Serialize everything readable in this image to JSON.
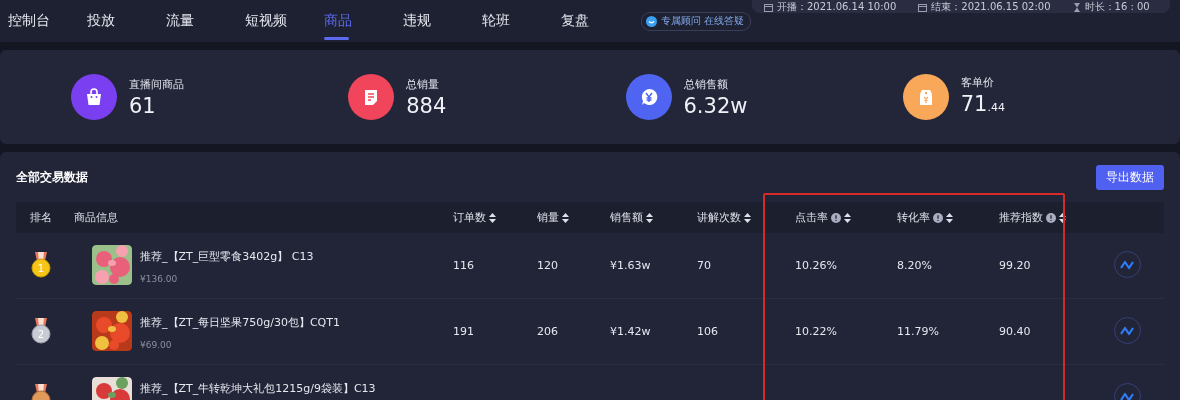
{
  "nav": {
    "tabs": [
      {
        "label": "控制台",
        "selected": false
      },
      {
        "label": "投放",
        "selected": false
      },
      {
        "label": "流量",
        "selected": false
      },
      {
        "label": "短视频",
        "selected": false
      },
      {
        "label": "商品",
        "selected": true
      },
      {
        "label": "违规",
        "selected": false
      },
      {
        "label": "轮班",
        "selected": false
      },
      {
        "label": "复盘",
        "selected": false
      }
    ],
    "advisor_badge": "专属顾问 在线答疑",
    "session_info": [
      {
        "kind": "start",
        "text": "开播：2021.06.14 10:00"
      },
      {
        "kind": "end",
        "text": "结束：2021.06.15 02:00"
      },
      {
        "kind": "duration",
        "text": "时长：16 : 00"
      }
    ]
  },
  "stats": [
    {
      "kind": "bag",
      "color": "#7b3ff2",
      "label": "直播间商品",
      "value": "61"
    },
    {
      "kind": "note",
      "color": "#f0455a",
      "label": "总销量",
      "value": "884"
    },
    {
      "kind": "yen",
      "color": "#4f64f0",
      "label": "总销售额",
      "value": "6.32w"
    },
    {
      "kind": "tag",
      "color": "#f9a85a",
      "label": "客单价",
      "value": "71",
      "value_small": ".44"
    }
  ],
  "table": {
    "title": "全部交易数据",
    "export_button": "导出数据",
    "columns": [
      {
        "label": "排名",
        "sortable": false,
        "info": false
      },
      {
        "label": "商品信息",
        "sortable": false,
        "info": false
      },
      {
        "label": "订单数",
        "sortable": true,
        "info": false
      },
      {
        "label": "销量",
        "sortable": true,
        "info": false
      },
      {
        "label": "销售额",
        "sortable": true,
        "info": false
      },
      {
        "label": "讲解次数",
        "sortable": true,
        "info": false
      },
      {
        "label": "点击率",
        "sortable": true,
        "info": true
      },
      {
        "label": "转化率",
        "sortable": true,
        "info": true
      },
      {
        "label": "推荐指数",
        "sortable": true,
        "info": true
      }
    ],
    "rows": [
      {
        "rank": "1",
        "name": "推荐_【ZT_巨型零食3402g】 C13",
        "price": "¥136.00",
        "orders": "116",
        "sales": "120",
        "revenue": "¥1.63w",
        "explains": "70",
        "click_rate": "10.26%",
        "conversion": "8.20%",
        "score": "99.20"
      },
      {
        "rank": "2",
        "name": "推荐_【ZT_每日坚果750g/30包】CQT1",
        "price": "¥69.00",
        "orders": "191",
        "sales": "206",
        "revenue": "¥1.42w",
        "explains": "106",
        "click_rate": "10.22%",
        "conversion": "11.79%",
        "score": "90.40"
      },
      {
        "name": "推荐_【ZT_牛转乾坤大礼包1215g/9袋装】C13"
      }
    ]
  }
}
